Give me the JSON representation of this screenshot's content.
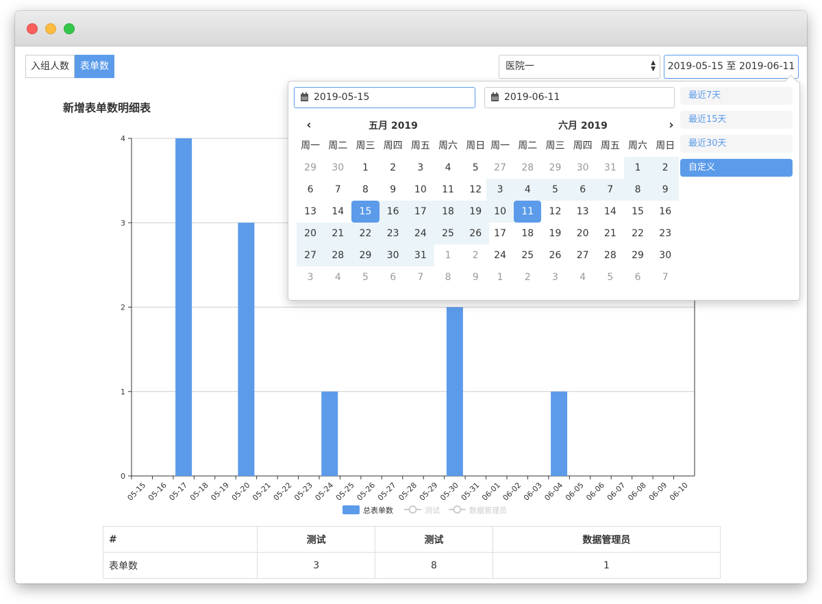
{
  "tabs": [
    {
      "label": "入组人数",
      "active": false
    },
    {
      "label": "表单数",
      "active": true
    }
  ],
  "hospital_select": {
    "value": "医院一"
  },
  "date_range": {
    "value": "2019-05-15 至 2019-06-11"
  },
  "chart": {
    "title": "新增表单数明细表"
  },
  "chart_data": {
    "type": "bar",
    "categories": [
      "05-15",
      "05-16",
      "05-17",
      "05-18",
      "05-19",
      "05-20",
      "05-21",
      "05-22",
      "05-23",
      "05-24",
      "05-25",
      "05-26",
      "05-27",
      "05-28",
      "05-29",
      "05-30",
      "05-31",
      "06-01",
      "06-02",
      "06-03",
      "06-04",
      "06-05",
      "06-06",
      "06-07",
      "06-08",
      "06-09",
      "06-10"
    ],
    "series": [
      {
        "name": "总表单数",
        "values": [
          0,
          0,
          4,
          0,
          0,
          3,
          0,
          0,
          0,
          1,
          0,
          0,
          0,
          0,
          0,
          2,
          0,
          0,
          0,
          0,
          1,
          0,
          0,
          0,
          0,
          0,
          0
        ],
        "visible": true
      },
      {
        "name": "测试",
        "visible": false
      },
      {
        "name": "数据管理员",
        "visible": false
      }
    ],
    "yticks": [
      0,
      1,
      2,
      3,
      4
    ],
    "ylim": [
      0,
      4
    ],
    "grid": true,
    "legend": "bottom",
    "colors": {
      "bar": "#5b9bea",
      "legend_inactive": "#cccccc"
    }
  },
  "picker": {
    "start_input": "2019-05-15",
    "end_input": "2019-06-11",
    "prev_icon": "chevron-left-icon",
    "next_icon": "chevron-right-icon",
    "weekdays": [
      "周一",
      "周二",
      "周三",
      "周四",
      "周五",
      "周六",
      "周日"
    ],
    "left": {
      "title": "五月 2019",
      "days": [
        [
          "29",
          "30",
          "1",
          "2",
          "3",
          "4",
          "5"
        ],
        [
          "6",
          "7",
          "8",
          "9",
          "10",
          "11",
          "12"
        ],
        [
          "13",
          "14",
          "15",
          "16",
          "17",
          "18",
          "19"
        ],
        [
          "20",
          "21",
          "22",
          "23",
          "24",
          "25",
          "26"
        ],
        [
          "27",
          "28",
          "29",
          "30",
          "31",
          "1",
          "2"
        ],
        [
          "3",
          "4",
          "5",
          "6",
          "7",
          "8",
          "9"
        ]
      ],
      "state": [
        [
          "off",
          "off",
          "",
          "",
          "",
          "",
          ""
        ],
        [
          "",
          "",
          "",
          "",
          "",
          "",
          ""
        ],
        [
          "",
          "",
          "sel",
          "inr",
          "inr",
          "inr",
          "inr"
        ],
        [
          "inr",
          "inr",
          "inr",
          "inr",
          "inr",
          "inr",
          "inr"
        ],
        [
          "inr",
          "inr",
          "inr",
          "inr",
          "inr",
          "off",
          "off"
        ],
        [
          "off",
          "off",
          "off",
          "off",
          "off",
          "off",
          "off"
        ]
      ]
    },
    "right": {
      "title": "六月 2019",
      "days": [
        [
          "27",
          "28",
          "29",
          "30",
          "31",
          "1",
          "2"
        ],
        [
          "3",
          "4",
          "5",
          "6",
          "7",
          "8",
          "9"
        ],
        [
          "10",
          "11",
          "12",
          "13",
          "14",
          "15",
          "16"
        ],
        [
          "17",
          "18",
          "19",
          "20",
          "21",
          "22",
          "23"
        ],
        [
          "24",
          "25",
          "26",
          "27",
          "28",
          "29",
          "30"
        ],
        [
          "1",
          "2",
          "3",
          "4",
          "5",
          "6",
          "7"
        ]
      ],
      "state": [
        [
          "off",
          "off",
          "off",
          "off",
          "off",
          "inr",
          "inr"
        ],
        [
          "inr",
          "inr",
          "inr",
          "inr",
          "inr",
          "inr",
          "inr"
        ],
        [
          "inr",
          "sel",
          "",
          "",
          "",
          "",
          ""
        ],
        [
          "",
          "",
          "",
          "",
          "",
          "",
          ""
        ],
        [
          "",
          "",
          "",
          "",
          "",
          "",
          ""
        ],
        [
          "off",
          "off",
          "off",
          "off",
          "off",
          "off",
          "off"
        ]
      ]
    },
    "ranges": [
      {
        "label": "最近7天",
        "active": false
      },
      {
        "label": "最近15天",
        "active": false
      },
      {
        "label": "最近30天",
        "active": false
      },
      {
        "label": "自定义",
        "active": true
      }
    ],
    "colors": {
      "accent": "#5b9bea",
      "in_range": "#ebf4f8"
    }
  },
  "table": {
    "headers": [
      "#",
      "测试",
      "测试",
      "数据管理员"
    ],
    "rows": [
      [
        "表单数",
        "3",
        "8",
        "1"
      ]
    ]
  }
}
